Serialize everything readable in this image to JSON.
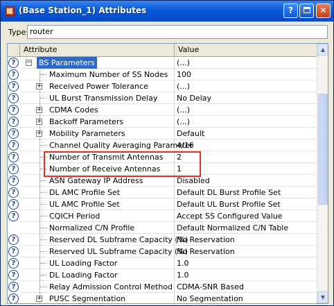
{
  "window": {
    "title": "(Base Station_1) Attributes",
    "help_glyph": "?",
    "close_glyph": "✕"
  },
  "type_field": {
    "label": "Type:",
    "value": "router"
  },
  "grid": {
    "header": {
      "attribute": "Attribute",
      "value": "Value"
    },
    "rows": [
      {
        "label": "BS Parameters",
        "value": "(...)",
        "help": true,
        "expander": "−",
        "level": 0,
        "selected": true
      },
      {
        "label": "Maximum Number of SS Nodes",
        "value": "100",
        "help": true,
        "expander": "",
        "level": 1
      },
      {
        "label": "Received Power Tolerance",
        "value": "(...)",
        "help": true,
        "expander": "+",
        "level": 1
      },
      {
        "label": "UL Burst Transmission Delay",
        "value": "No Delay",
        "help": true,
        "expander": "",
        "level": 1
      },
      {
        "label": "CDMA Codes",
        "value": "(...)",
        "help": true,
        "expander": "+",
        "level": 1
      },
      {
        "label": "Backoff Parameters",
        "value": "(...)",
        "help": true,
        "expander": "+",
        "level": 1
      },
      {
        "label": "Mobility Parameters",
        "value": "Default",
        "help": true,
        "expander": "+",
        "level": 1
      },
      {
        "label": "Channel Quality Averaging Parameter",
        "value": "4/16",
        "help": true,
        "expander": "",
        "level": 1
      },
      {
        "label": "Number of Transmit Antennas",
        "value": "2",
        "help": true,
        "expander": "",
        "level": 1
      },
      {
        "label": "Number of Receive Antennas",
        "value": "1",
        "help": true,
        "expander": "",
        "level": 1
      },
      {
        "label": "ASN Gateway IP Address",
        "value": "Disabled",
        "help": true,
        "expander": "",
        "level": 1
      },
      {
        "label": "DL AMC Profile Set",
        "value": "Default DL Burst Profile Set",
        "help": true,
        "expander": "",
        "level": 1
      },
      {
        "label": "UL AMC Profile Set",
        "value": "Default UL Burst Profile Set",
        "help": true,
        "expander": "",
        "level": 1
      },
      {
        "label": "CQICH Period",
        "value": "Accept SS Configured Value",
        "help": true,
        "expander": "",
        "level": 1
      },
      {
        "label": "Normalized C/N Profile",
        "value": "Default Normalized C/N Table",
        "help": false,
        "expander": "",
        "level": 1
      },
      {
        "label": "Reserved DL Subframe Capacity (%)",
        "value": "No Reservation",
        "help": true,
        "expander": "",
        "level": 1
      },
      {
        "label": "Reserved UL Subframe Capacity (%)",
        "value": "No Reservation",
        "help": true,
        "expander": "",
        "level": 1
      },
      {
        "label": "UL Loading Factor",
        "value": "1.0",
        "help": true,
        "expander": "",
        "level": 1
      },
      {
        "label": "DL Loading Factor",
        "value": "1.0",
        "help": true,
        "expander": "",
        "level": 1
      },
      {
        "label": "Relay Admission Control Method",
        "value": "CDMA-SNR Based",
        "help": true,
        "expander": "",
        "level": 1
      },
      {
        "label": "PUSC Segmentation",
        "value": "No Segmentation",
        "help": true,
        "expander": "+",
        "level": 1
      }
    ]
  },
  "colors": {
    "titlebar": "#0a5ddc",
    "selection": "#316ac5",
    "annotation_box": "#e0302a"
  }
}
